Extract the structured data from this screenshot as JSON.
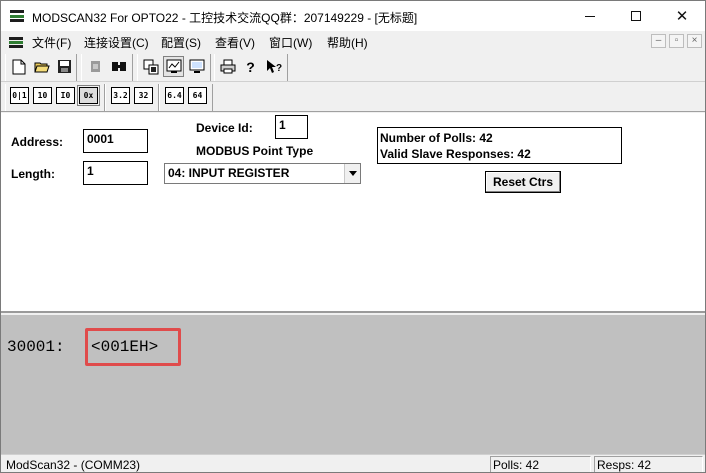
{
  "window": {
    "title": "MODSCAN32 For OPTO22 - 工控技术交流QQ群：207149229 - [无标题]"
  },
  "menu": {
    "items": [
      {
        "label": "文件(F)"
      },
      {
        "label": "连接设置(C)"
      },
      {
        "label": "配置(S)"
      },
      {
        "label": "查看(V)"
      },
      {
        "label": "窗口(W)"
      },
      {
        "label": "帮助(H)"
      }
    ],
    "mdi_buttons": [
      "–",
      "▫",
      "×"
    ]
  },
  "toolbar1": {
    "icons": [
      "new-file-icon",
      "open-folder-icon",
      "save-icon",
      "connect-icon",
      "disconnect-icon",
      "display-options-icon",
      "graph-icon",
      "print-setup-icon",
      "print-icon",
      "help-icon",
      "context-help-icon"
    ]
  },
  "toolbar2": {
    "format_buttons": [
      "0|1",
      "10",
      "I0",
      "0x",
      "3.2",
      "32",
      "6.4",
      "64"
    ]
  },
  "form": {
    "address_label": "Address:",
    "address_value": "0001",
    "length_label": "Length:",
    "length_value": "1",
    "device_id_label": "Device Id:",
    "device_id_value": "1",
    "point_type_label": "MODBUS Point Type",
    "point_type_value": "04: INPUT REGISTER",
    "polls_line": "Number of Polls: 42",
    "responses_line": "Valid Slave Responses: 42",
    "reset_button": "Reset Ctrs"
  },
  "data": {
    "register_address": "30001:",
    "register_value": "<001EH>"
  },
  "status": {
    "app": "ModScan32 - (COMM23)",
    "polls": "Polls: 42",
    "resps": "Resps: 42"
  }
}
